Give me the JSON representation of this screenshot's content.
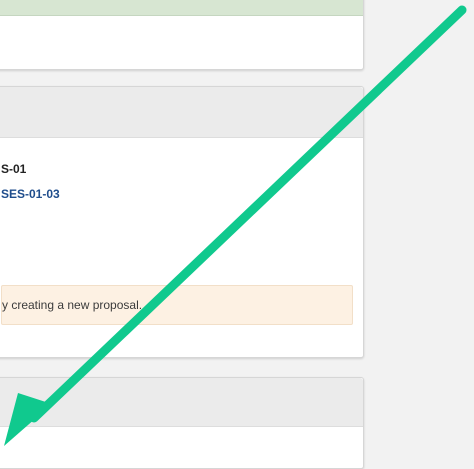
{
  "panels": {
    "middle": {
      "reference_code": "S-01",
      "reference_link": "SES-01-03",
      "notice_text": "y creating a new proposal."
    }
  },
  "colors": {
    "annotation_arrow": "#10c98e",
    "link": "#1f4d8c",
    "notice_background": "#fdf1e3",
    "success_header": "#d7e6d2"
  },
  "annotation": {
    "type": "arrow",
    "direction": "down-left"
  }
}
